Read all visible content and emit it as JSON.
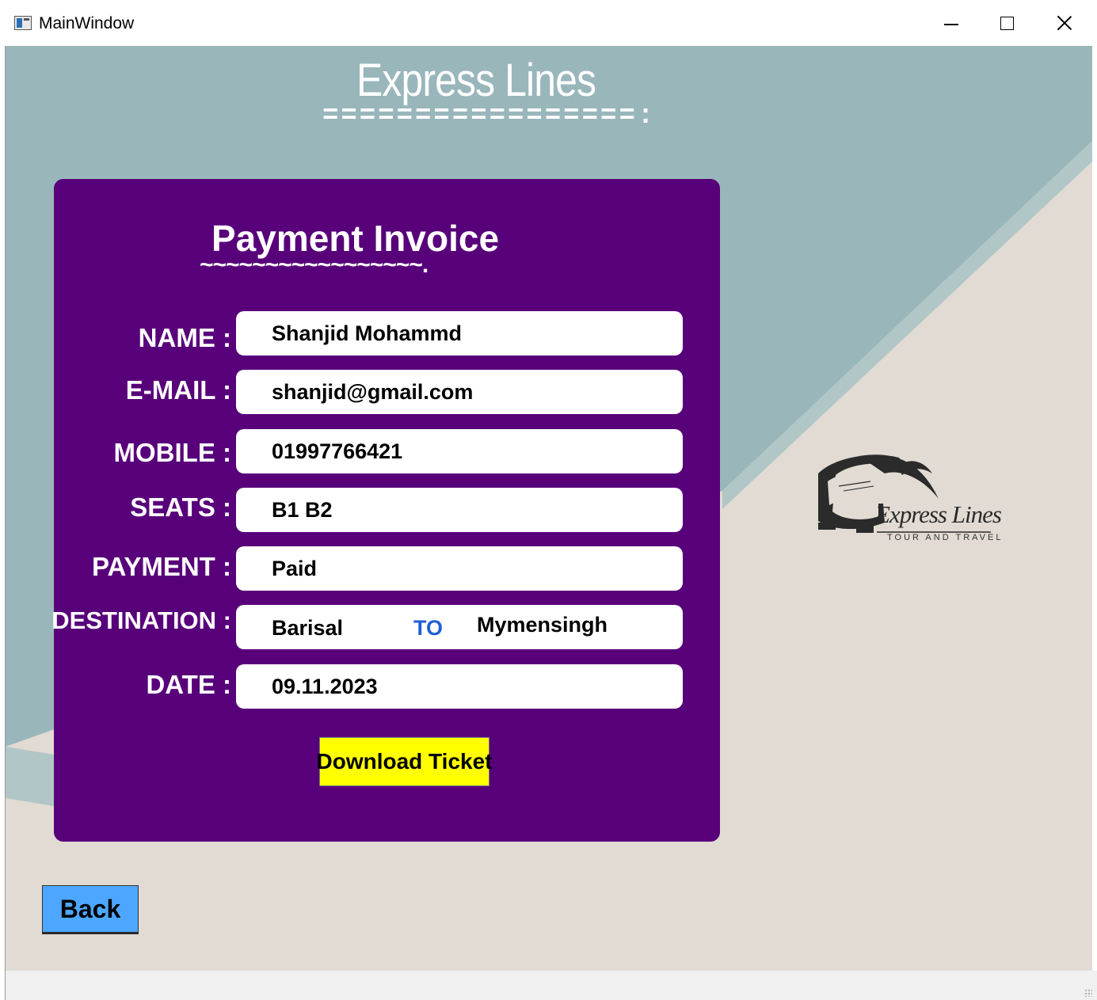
{
  "window": {
    "title": "MainWindow"
  },
  "header": {
    "brand_title": "Express Lines",
    "brand_underline": "=================:"
  },
  "invoice": {
    "title": "Payment Invoice",
    "title_underline": "~~~~~~~~~~~~~~~~~.",
    "rows": {
      "name": {
        "label": "NAME :",
        "value": "Shanjid Mohammd"
      },
      "email": {
        "label": "E-MAIL :",
        "value": "shanjid@gmail.com"
      },
      "mobile": {
        "label": "MOBILE :",
        "value": "01997766421"
      },
      "seats": {
        "label": "SEATS :",
        "value": "B1 B2"
      },
      "payment": {
        "label": "PAYMENT :",
        "value": "Paid"
      },
      "destination": {
        "label": "DESTINATION :",
        "from": "Barisal",
        "to_label": "TO",
        "to": "Mymensingh"
      },
      "date": {
        "label": "DATE :",
        "value": "09.11.2023"
      }
    },
    "download_button": "Download Ticket"
  },
  "back_button": "Back",
  "logo": {
    "name": "Express Lines",
    "tagline": "TOUR AND TRAVEL",
    "icon": "bus-icon"
  },
  "colors": {
    "panel": "#58007a",
    "background_teal": "#99b6bb",
    "background_beige": "#e1dbd3",
    "download_button": "#ffff00",
    "back_button": "#4da6ff",
    "to_text": "#1e5ed8"
  }
}
